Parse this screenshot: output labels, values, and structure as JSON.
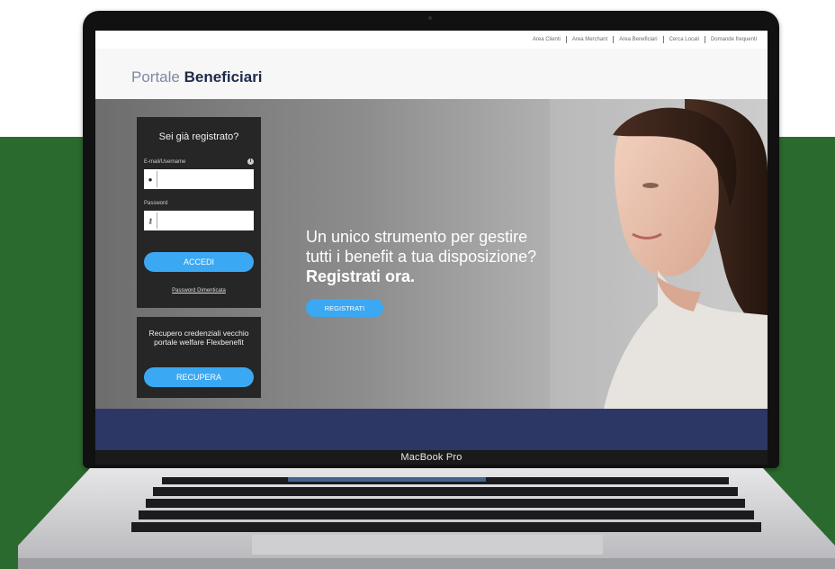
{
  "device_label": "MacBook Pro",
  "top_nav": [
    "Area Clienti",
    "Area Merchant",
    "Area Beneficiari",
    "Cerca Locali",
    "Domande frequenti"
  ],
  "brand": {
    "light": "Portale",
    "bold": "Beneficiari"
  },
  "login": {
    "title": "Sei già registrato?",
    "email_label": "E-mail/Username",
    "password_label": "Password",
    "submit_label": "ACCEDI",
    "forgot_label": "Password Dimenticata"
  },
  "recover": {
    "text": "Recupero credenziali vecchio portale welfare Flexbenefit",
    "button_label": "RECUPERA"
  },
  "hero": {
    "line1": "Un unico strumento per gestire",
    "line2": "tutti i benefit a tua disposizione?",
    "line3": "Registrati ora.",
    "button_label": "REGISTRATI"
  },
  "colors": {
    "green_band": "#2b6a2f",
    "accent_blue": "#3aa8f2",
    "navy_bar": "#2c3766",
    "panel_dark": "#262626"
  },
  "icons": {
    "user": "user-icon",
    "key": "key-icon",
    "info": "info-icon"
  }
}
